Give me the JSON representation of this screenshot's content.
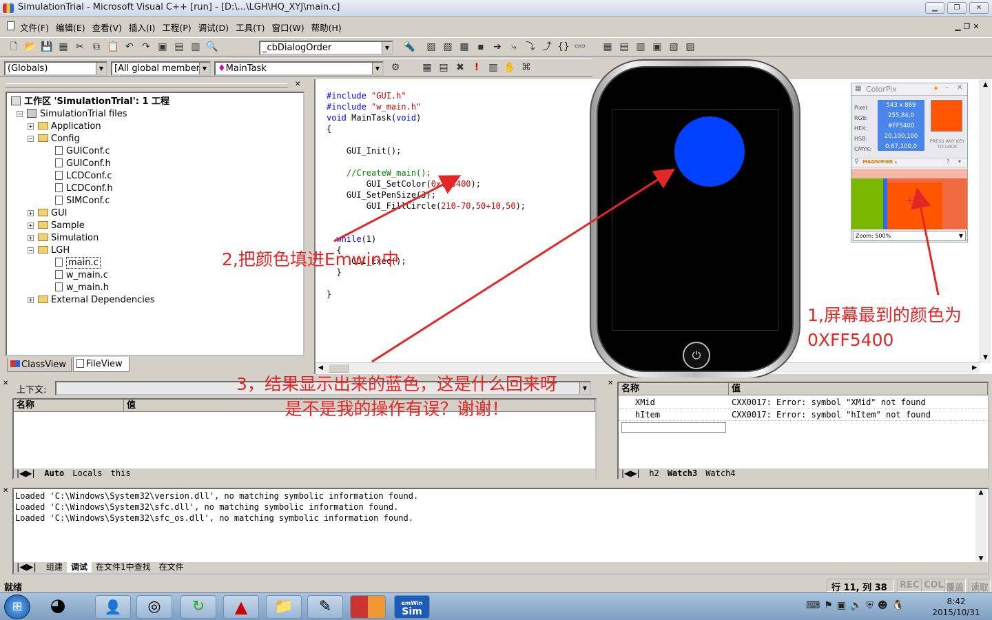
{
  "window": {
    "title": "SimulationTrial - Microsoft Visual C++ [run] - [D:\\...\\LGH\\HQ_XYJ\\main.c]"
  },
  "menu": [
    "文件(F)",
    "编辑(E)",
    "查看(V)",
    "插入(I)",
    "工程(P)",
    "调试(D)",
    "工具(T)",
    "窗口(W)",
    "帮助(H)"
  ],
  "toolbar": {
    "class_combo": "_cbDialogOrder",
    "globals": "(Globals)",
    "members": "[All global members",
    "function": "MainTask"
  },
  "workspace": {
    "title": "工作区 'SimulationTrial': 1 工程",
    "files_root": "SimulationTrial files",
    "application": "Application",
    "config": "Config",
    "config_files": [
      "GUIConf.c",
      "GUIConf.h",
      "LCDConf.c",
      "LCDConf.h",
      "SIMConf.c"
    ],
    "gui": "GUI",
    "sample": "Sample",
    "simulation": "Simulation",
    "lgh": "LGH",
    "lgh_files": [
      "main.c",
      "w_main.c",
      "w_main.h"
    ],
    "external": "External Dependencies",
    "tab_classview": "ClassView",
    "tab_fileview": "FileView"
  },
  "code": {
    "l1a": "#include ",
    "l1b": "\"GUI.h\"",
    "l2a": "#include ",
    "l2b": "\"w_main.h\"",
    "l3a": "void",
    "l3b": " MainTask(",
    "l3c": "void",
    "l3d": ")",
    "l4": "{",
    "l6": "GUI_Init();",
    "l8": "//CreateW_main();",
    "l9a": "GUI_SetColor(",
    "l9b": "0xff5400",
    "l9c": ");",
    "l10": "GUI_SetPenSize(3);",
    "l11a": "GUI_FillCircle(",
    "l11b": "210-70",
    "l11c": ",",
    "l11d": "50+10",
    "l11e": ",",
    "l11f": "50",
    "l11g": ");",
    "l14a": "while",
    "l14b": "(1)",
    "l15": "{",
    "l16": "GUI_Exec();",
    "l17": "}",
    "l19": "}"
  },
  "annotations": {
    "a1_line1": "1,屏幕最到的颜色为",
    "a1_line2": "0XFF5400",
    "a2": "2,把颜色填进Emwin中",
    "a3_line1": "3，结果显示出来的蓝色，这是什么回来呀",
    "a3_line2": "是不是我的操作有误？谢谢！"
  },
  "colorpix": {
    "title": "ColorPix",
    "pixel_label": "Pixel:",
    "pixel": "543 x 869",
    "rgb_label": "RGB:",
    "rgb": "255,84,0",
    "hex_label": "HEX:",
    "hex": "#FF5400",
    "hsb_label": "HSB:",
    "hsb": "20,100,100",
    "cmyk_label": "CMYK:",
    "cmyk": "0,67,100,0",
    "lock": "PRESS ANY KEY TO LOCK",
    "magnifier": "MAGNIFIER ▴",
    "zoom": "Zoom: 500%",
    "swatch": "#ff5400"
  },
  "sim": {
    "circle_color": "#0040ff"
  },
  "vars": {
    "context_label": "上下文:",
    "col_name": "名称",
    "col_value": "值",
    "tabs": [
      "Auto",
      "Locals",
      "this"
    ]
  },
  "watch": {
    "col_name": "名称",
    "col_value": "值",
    "rows": [
      {
        "name": "XMid",
        "value": "CXX0017: Error: symbol \"XMid\" not found"
      },
      {
        "name": "hItem",
        "value": "CXX0017: Error: symbol \"hItem\" not found"
      }
    ],
    "tabs": [
      "h2",
      "Watch3",
      "Watch4"
    ]
  },
  "output": {
    "lines": [
      "Loaded 'C:\\Windows\\System32\\version.dll', no matching symbolic information found.",
      "Loaded 'C:\\Windows\\System32\\sfc.dll', no matching symbolic information found.",
      "Loaded 'C:\\Windows\\System32\\sfc_os.dll', no matching symbolic information found."
    ],
    "tabs": [
      "组建",
      "调试",
      "在文件1中查找",
      "在文件"
    ]
  },
  "status": {
    "ready": "就绪",
    "pos": "行 11, 列 38",
    "rec": "REC",
    "col": "COL",
    "ovr": "覆盖",
    "read": "读取"
  },
  "taskbar": {
    "time": "8:42",
    "date": "2015/10/31",
    "emwin_top": "emWin",
    "emwin_bottom": "Sim"
  }
}
